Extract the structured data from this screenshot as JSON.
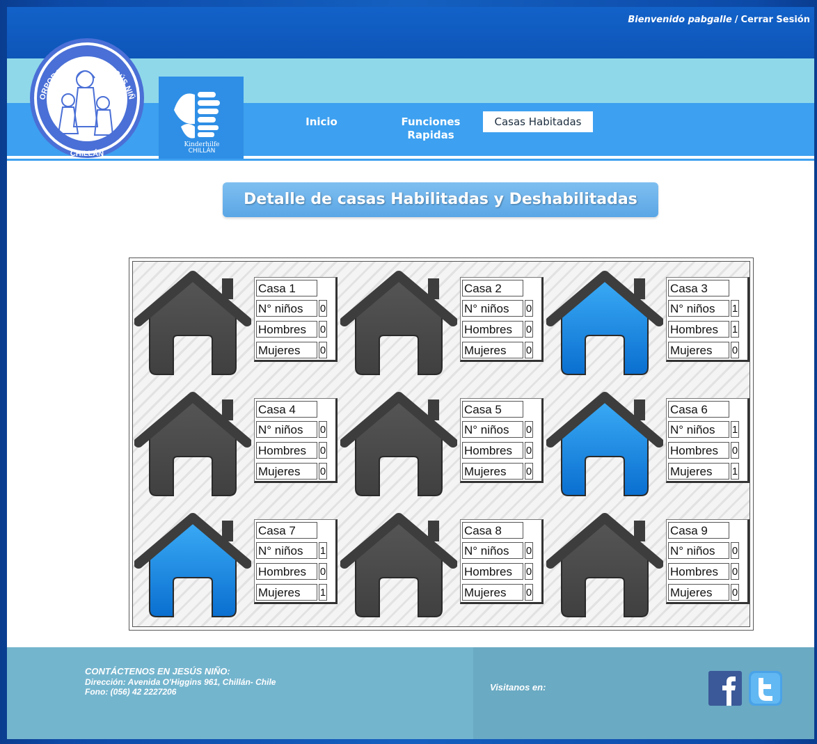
{
  "header": {
    "welcome_text": "Bienvenido pabgalle",
    "separator": "/",
    "logout_label": "Cerrar Sesión",
    "seal_text_top": "CORPORACIÓN VILLA JESÚS NIÑO",
    "seal_text_bottom": "CHILLÁN",
    "kinder_line1": "Kinderhilfe",
    "kinder_line2": "CHILLÁN"
  },
  "nav": {
    "inicio": "Inicio",
    "funciones_line1": "Funciones",
    "funciones_line2": "Rapidas",
    "casas": "Casas Habitadas"
  },
  "page_title": "Detalle de casas Habilitadas y Deshabilitadas",
  "labels": {
    "ninos": "N° niños",
    "hombres": "Hombres",
    "mujeres": "Mujeres"
  },
  "houses": [
    {
      "name": "Casa 1",
      "ninos": "0",
      "hombres": "0",
      "mujeres": "0",
      "active": false
    },
    {
      "name": "Casa 2",
      "ninos": "0",
      "hombres": "0",
      "mujeres": "0",
      "active": false
    },
    {
      "name": "Casa 3",
      "ninos": "1",
      "hombres": "1",
      "mujeres": "0",
      "active": true
    },
    {
      "name": "Casa 4",
      "ninos": "0",
      "hombres": "0",
      "mujeres": "0",
      "active": false
    },
    {
      "name": "Casa 5",
      "ninos": "0",
      "hombres": "0",
      "mujeres": "0",
      "active": false
    },
    {
      "name": "Casa 6",
      "ninos": "1",
      "hombres": "0",
      "mujeres": "1",
      "active": true
    },
    {
      "name": "Casa 7",
      "ninos": "1",
      "hombres": "0",
      "mujeres": "1",
      "active": true
    },
    {
      "name": "Casa 8",
      "ninos": "0",
      "hombres": "0",
      "mujeres": "0",
      "active": false
    },
    {
      "name": "Casa 9",
      "ninos": "0",
      "hombres": "0",
      "mujeres": "0",
      "active": false
    }
  ],
  "colors": {
    "house_inactive": "#4a4a4a",
    "house_active": "#1a8ee8",
    "roof": "#3d3d3d"
  },
  "footer": {
    "title": "CONTÁCTENOS EN JESÚS NIÑO:",
    "address": "Dirección: Avenida O'Higgins 961, Chillán- Chile",
    "phone": "Fono: (056) 42 2227206",
    "visit": "Visitanos en:",
    "facebook_icon": "facebook-icon",
    "twitter_icon": "twitter-icon"
  }
}
